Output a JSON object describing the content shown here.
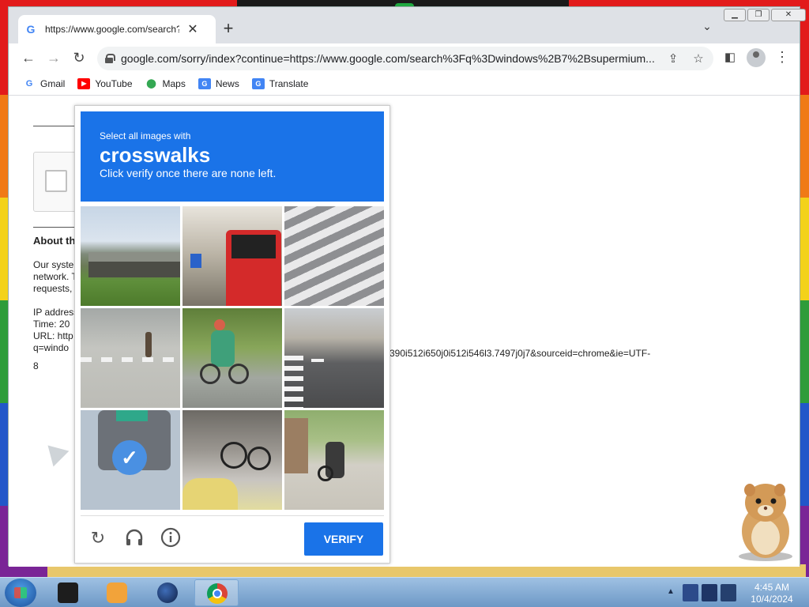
{
  "browser": {
    "tab_title": "https://www.google.com/search?",
    "tab_close": "✕",
    "new_tab": "+",
    "url": "google.com/sorry/index?continue=https://www.google.com/search%3Fq%3Dwindows%2B7%2Bsupermium...",
    "bookmarks": [
      {
        "label": "Gmail",
        "icon": "gmail-icon"
      },
      {
        "label": "YouTube",
        "icon": "youtube-icon"
      },
      {
        "label": "Maps",
        "icon": "maps-icon"
      },
      {
        "label": "News",
        "icon": "news-icon"
      },
      {
        "label": "Translate",
        "icon": "translate-icon"
      }
    ]
  },
  "page": {
    "about": "About this page",
    "lines": [
      "Our systems have detected unusual traffic from your computer",
      "network. This page checks to see if it's really you sending the",
      "requests, and not a robot."
    ],
    "ip": "IP address:",
    "time": "Time: 20",
    "url_label": "URL: http",
    "url_q": "q=windo",
    "url_tail": "390i512i650j0i512i546l3.7497j0j7&sourceid=chrome&ie=UTF-",
    "url_end": "8"
  },
  "captcha": {
    "select_text": "Select all images with",
    "target": "crosswalks",
    "instruction": "Click verify once there are none left.",
    "verify_label": "VERIFY",
    "tiles": [
      {
        "desc": "bridge",
        "selected": false
      },
      {
        "desc": "bus",
        "selected": false
      },
      {
        "desc": "crosswalk",
        "selected": false
      },
      {
        "desc": "street-pedestrian",
        "selected": false
      },
      {
        "desc": "cyclist",
        "selected": false
      },
      {
        "desc": "road-markings",
        "selected": false
      },
      {
        "desc": "traffic-light",
        "selected": true
      },
      {
        "desc": "bicycles",
        "selected": false
      },
      {
        "desc": "motorcycle",
        "selected": false
      }
    ]
  },
  "taskbar": {
    "time": "4:45 AM",
    "date": "10/4/2024"
  },
  "colors": {
    "accent": "#1a73e8",
    "check": "#4a90e2"
  }
}
